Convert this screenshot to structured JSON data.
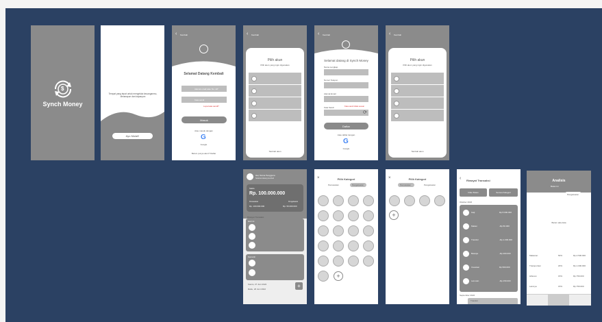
{
  "splash": {
    "app_name": "Synch Money",
    "logo_symbol": "$"
  },
  "intro": {
    "description": "Tempat yang tepat untuk mengelola keuanganmu, dimanapun dan kapanpun",
    "button": "Ayo Mulai!!"
  },
  "login": {
    "back": "Kembali",
    "title": "Selamat Datang Kembali",
    "email_placeholder": "Alamat email atau No. HP",
    "password_placeholder": "Kata sandi",
    "forgot": "Lupa kata sandi?",
    "submit": "Masuk",
    "or": "Atau masuk dengan",
    "google": "Google",
    "register": "Belum punya akun? Daftar"
  },
  "choose_account_1": {
    "back": "Kembali",
    "heading": "Pilih akun",
    "sub": "Pilih akun yang ingin digunakan",
    "footer": "Tambah akun"
  },
  "register": {
    "back": "Kembali",
    "title": "Selamat datang di Synch Money",
    "f1": "Nama Lengkap",
    "f2": "Nomor Telepon",
    "f3": "Alamat Email",
    "f4": "Kata Sandi",
    "error": "Kata sandi tidak sesuai",
    "submit": "Daftar",
    "or": "Atau daftar dengan",
    "google": "Google"
  },
  "choose_account_2": {
    "back": "Kembali",
    "heading": "Pilih akun",
    "sub": "Pilih akun yang ingin digunakan",
    "footer": "Tambah akun"
  },
  "dashboard": {
    "user": "Hai, Nama Pengguna",
    "user_sub": "Selamat datang kembali",
    "balance_label": "Saldo",
    "balance": "Rp. 100.000.000",
    "in_label": "Pemasukan",
    "in_val": "Rp. 100.000.000",
    "out_label": "Pengeluaran",
    "out_val": "Rp. 50.000.000",
    "section": "Riwayat Transaksi",
    "today": "Hari ini",
    "yesterday": "Kemarin",
    "d1": "Kamis, 27 Juni 2022",
    "d2": "Rabu, 26 Juni 2022"
  },
  "kategori1": {
    "title": "Pilih Kategori",
    "tab1": "Pemasukan",
    "tab2": "Pengeluaran"
  },
  "kategori2": {
    "title": "Pilih Kategori",
    "tab1": "Pemasukan",
    "tab2": "Pengeluaran"
  },
  "riwayat": {
    "back": "Riwayat Transaksi",
    "filter1": "Filter Bulan",
    "filter2": "Semua Kategori",
    "month1": "Oktober 2022",
    "month2": "September 2022",
    "items": [
      {
        "label": "Gaji",
        "amount": "Rp.5.000.000"
      },
      {
        "label": "Makan",
        "amount": "-Rp.50.000"
      },
      {
        "label": "Transfer",
        "amount": "-Rp.1.000.000"
      },
      {
        "label": "Belanja",
        "amount": "-Rp.200.000"
      },
      {
        "label": "Investasi",
        "amount": "Rp.500.000"
      },
      {
        "label": "Lain-lain",
        "amount": "-Rp.150.000"
      }
    ],
    "last": "Transfer"
  },
  "analisis": {
    "title": "Analisis",
    "period": "Bulan Ini",
    "tab1": "Pemasukan",
    "tab2": "Pengeluaran",
    "empty": "Belum ada data",
    "rows": [
      {
        "label": "Makanan",
        "pct": "50%",
        "val": "Rp.2.500.000"
      },
      {
        "label": "Transportasi",
        "pct": "20%",
        "val": "Rp.1.000.000"
      },
      {
        "label": "Hiburan",
        "pct": "15%",
        "val": "Rp.750.000"
      },
      {
        "label": "Lainnya",
        "pct": "15%",
        "val": "Rp.750.000"
      }
    ]
  }
}
